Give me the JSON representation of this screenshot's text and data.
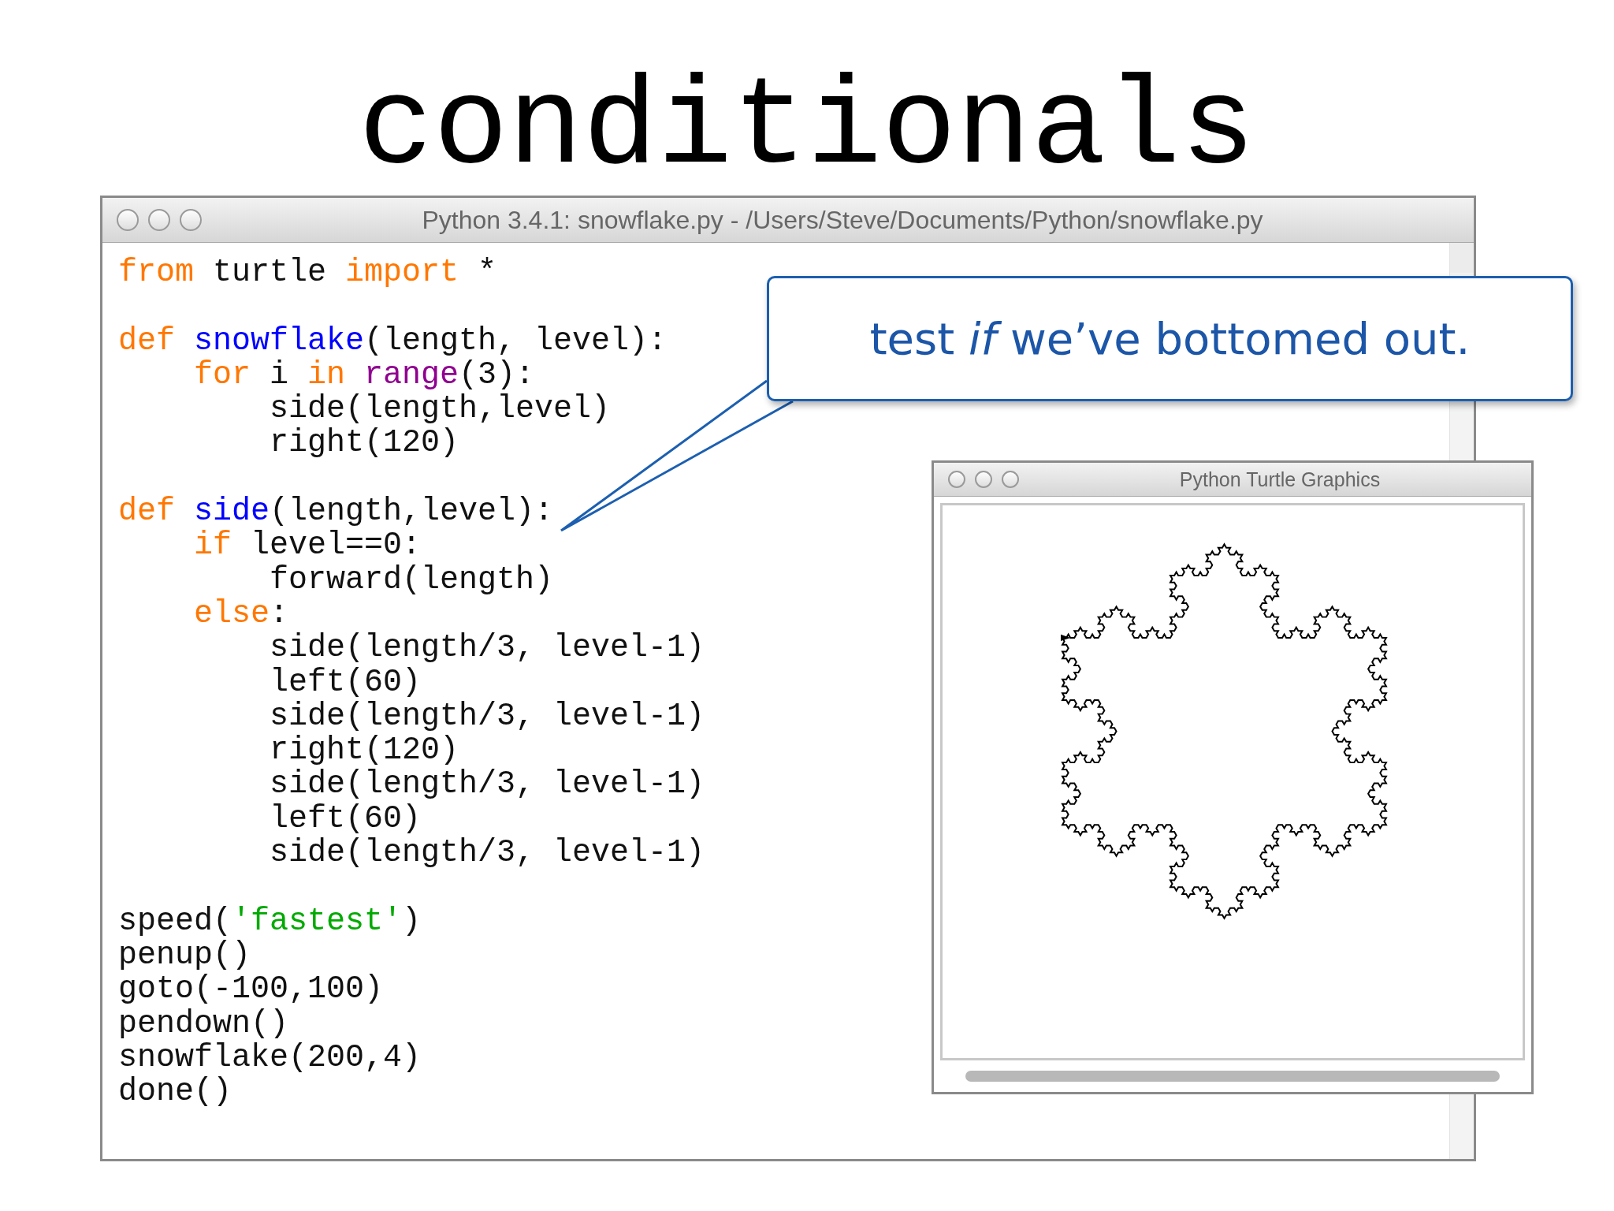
{
  "slide_title": "conditionals",
  "editor": {
    "title": "Python 3.4.1: snowflake.py - /Users/Steve/Documents/Python/snowflake.py",
    "lines": [
      {
        "kind": "code",
        "tokens": [
          {
            "kind": "keyword",
            "text": "from"
          },
          {
            "kind": "plain",
            "text": " turtle "
          },
          {
            "kind": "keyword",
            "text": "import"
          },
          {
            "kind": "plain",
            "text": " *"
          }
        ]
      },
      {
        "kind": "blank"
      },
      {
        "kind": "code",
        "tokens": [
          {
            "kind": "keyword",
            "text": "def "
          },
          {
            "kind": "defname",
            "text": "snowflake"
          },
          {
            "kind": "plain",
            "text": "(length, level):"
          }
        ]
      },
      {
        "kind": "code",
        "tokens": [
          {
            "kind": "keyword",
            "text": "    for"
          },
          {
            "kind": "plain",
            "text": " i "
          },
          {
            "kind": "keyword",
            "text": "in "
          },
          {
            "kind": "builtin",
            "text": "range"
          },
          {
            "kind": "plain",
            "text": "(3):"
          }
        ]
      },
      {
        "kind": "code",
        "tokens": [
          {
            "kind": "plain",
            "text": "        side(length,level)"
          }
        ]
      },
      {
        "kind": "code",
        "tokens": [
          {
            "kind": "plain",
            "text": "        right(120)"
          }
        ]
      },
      {
        "kind": "blank"
      },
      {
        "kind": "code",
        "tokens": [
          {
            "kind": "keyword",
            "text": "def "
          },
          {
            "kind": "defname",
            "text": "side"
          },
          {
            "kind": "plain",
            "text": "(length,level):"
          }
        ]
      },
      {
        "kind": "code",
        "tokens": [
          {
            "kind": "keyword",
            "text": "    if"
          },
          {
            "kind": "plain",
            "text": " level==0:"
          }
        ]
      },
      {
        "kind": "code",
        "tokens": [
          {
            "kind": "plain",
            "text": "        forward(length)"
          }
        ]
      },
      {
        "kind": "code",
        "tokens": [
          {
            "kind": "keyword",
            "text": "    else"
          },
          {
            "kind": "plain",
            "text": ":"
          }
        ]
      },
      {
        "kind": "code",
        "tokens": [
          {
            "kind": "plain",
            "text": "        side(length/3, level-1)"
          }
        ]
      },
      {
        "kind": "code",
        "tokens": [
          {
            "kind": "plain",
            "text": "        left(60)"
          }
        ]
      },
      {
        "kind": "code",
        "tokens": [
          {
            "kind": "plain",
            "text": "        side(length/3, level-1)"
          }
        ]
      },
      {
        "kind": "code",
        "tokens": [
          {
            "kind": "plain",
            "text": "        right(120)"
          }
        ]
      },
      {
        "kind": "code",
        "tokens": [
          {
            "kind": "plain",
            "text": "        side(length/3, level-1)"
          }
        ]
      },
      {
        "kind": "code",
        "tokens": [
          {
            "kind": "plain",
            "text": "        left(60)"
          }
        ]
      },
      {
        "kind": "code",
        "tokens": [
          {
            "kind": "plain",
            "text": "        side(length/3, level-1)"
          }
        ]
      },
      {
        "kind": "blank"
      },
      {
        "kind": "code",
        "tokens": [
          {
            "kind": "plain",
            "text": "speed("
          },
          {
            "kind": "string",
            "text": "'fastest'"
          },
          {
            "kind": "plain",
            "text": ")"
          }
        ]
      },
      {
        "kind": "code",
        "tokens": [
          {
            "kind": "plain",
            "text": "penup()"
          }
        ]
      },
      {
        "kind": "code",
        "tokens": [
          {
            "kind": "plain",
            "text": "goto(-100,100)"
          }
        ]
      },
      {
        "kind": "code",
        "tokens": [
          {
            "kind": "plain",
            "text": "pendown()"
          }
        ]
      },
      {
        "kind": "code",
        "tokens": [
          {
            "kind": "plain",
            "text": "snowflake(200,4)"
          }
        ]
      },
      {
        "kind": "code",
        "tokens": [
          {
            "kind": "plain",
            "text": "done()"
          }
        ]
      }
    ]
  },
  "callout": {
    "text": "test *if* we’ve bottomed out."
  },
  "turtle_window": {
    "title": "Python Turtle Graphics"
  }
}
